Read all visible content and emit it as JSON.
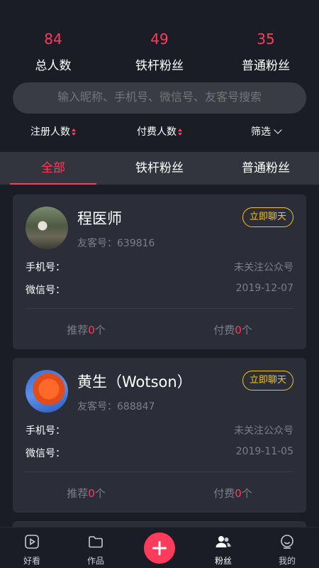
{
  "stats": [
    {
      "value": "84",
      "label": "总人数"
    },
    {
      "value": "49",
      "label": "铁杆粉丝"
    },
    {
      "value": "35",
      "label": "普通粉丝"
    }
  ],
  "search": {
    "placeholder": "输入昵称、手机号、微信号、友客号搜索"
  },
  "filters": {
    "register": "注册人数",
    "paid": "付费人数",
    "filter": "筛选"
  },
  "tabs": [
    {
      "label": "全部",
      "active": true
    },
    {
      "label": "铁杆粉丝",
      "active": false
    },
    {
      "label": "普通粉丝",
      "active": false
    }
  ],
  "fans": [
    {
      "name": "程医师",
      "id_label": "友客号：",
      "id": "639816",
      "chat_label": "立即聊天",
      "phone_label": "手机号：",
      "phone_status": "未关注公众号",
      "wechat_label": "微信号：",
      "date": "2019-12-07",
      "recommend_prefix": "推荐",
      "recommend_count": "0",
      "recommend_suffix": "个",
      "paid_prefix": "付费",
      "paid_count": "0",
      "paid_suffix": "个"
    },
    {
      "name": "黄生（Wotson）",
      "id_label": "友客号：",
      "id": "688847",
      "chat_label": "立即聊天",
      "phone_label": "手机号：",
      "phone_status": "未关注公众号",
      "wechat_label": "微信号：",
      "date": "2019-11-05",
      "recommend_prefix": "推荐",
      "recommend_count": "0",
      "recommend_suffix": "个",
      "paid_prefix": "付费",
      "paid_count": "0",
      "paid_suffix": "个"
    }
  ],
  "tabbar": [
    {
      "label": "好看",
      "icon": "play-icon"
    },
    {
      "label": "作品",
      "icon": "folder-icon"
    },
    {
      "label": "",
      "icon": "plus-icon"
    },
    {
      "label": "粉丝",
      "icon": "fans-icon",
      "active": true
    },
    {
      "label": "我的",
      "icon": "profile-icon"
    }
  ],
  "colors": {
    "accent": "#ff3b5c",
    "chat": "#f5c518",
    "background": "#1b1d26",
    "card": "#2b2d38"
  }
}
